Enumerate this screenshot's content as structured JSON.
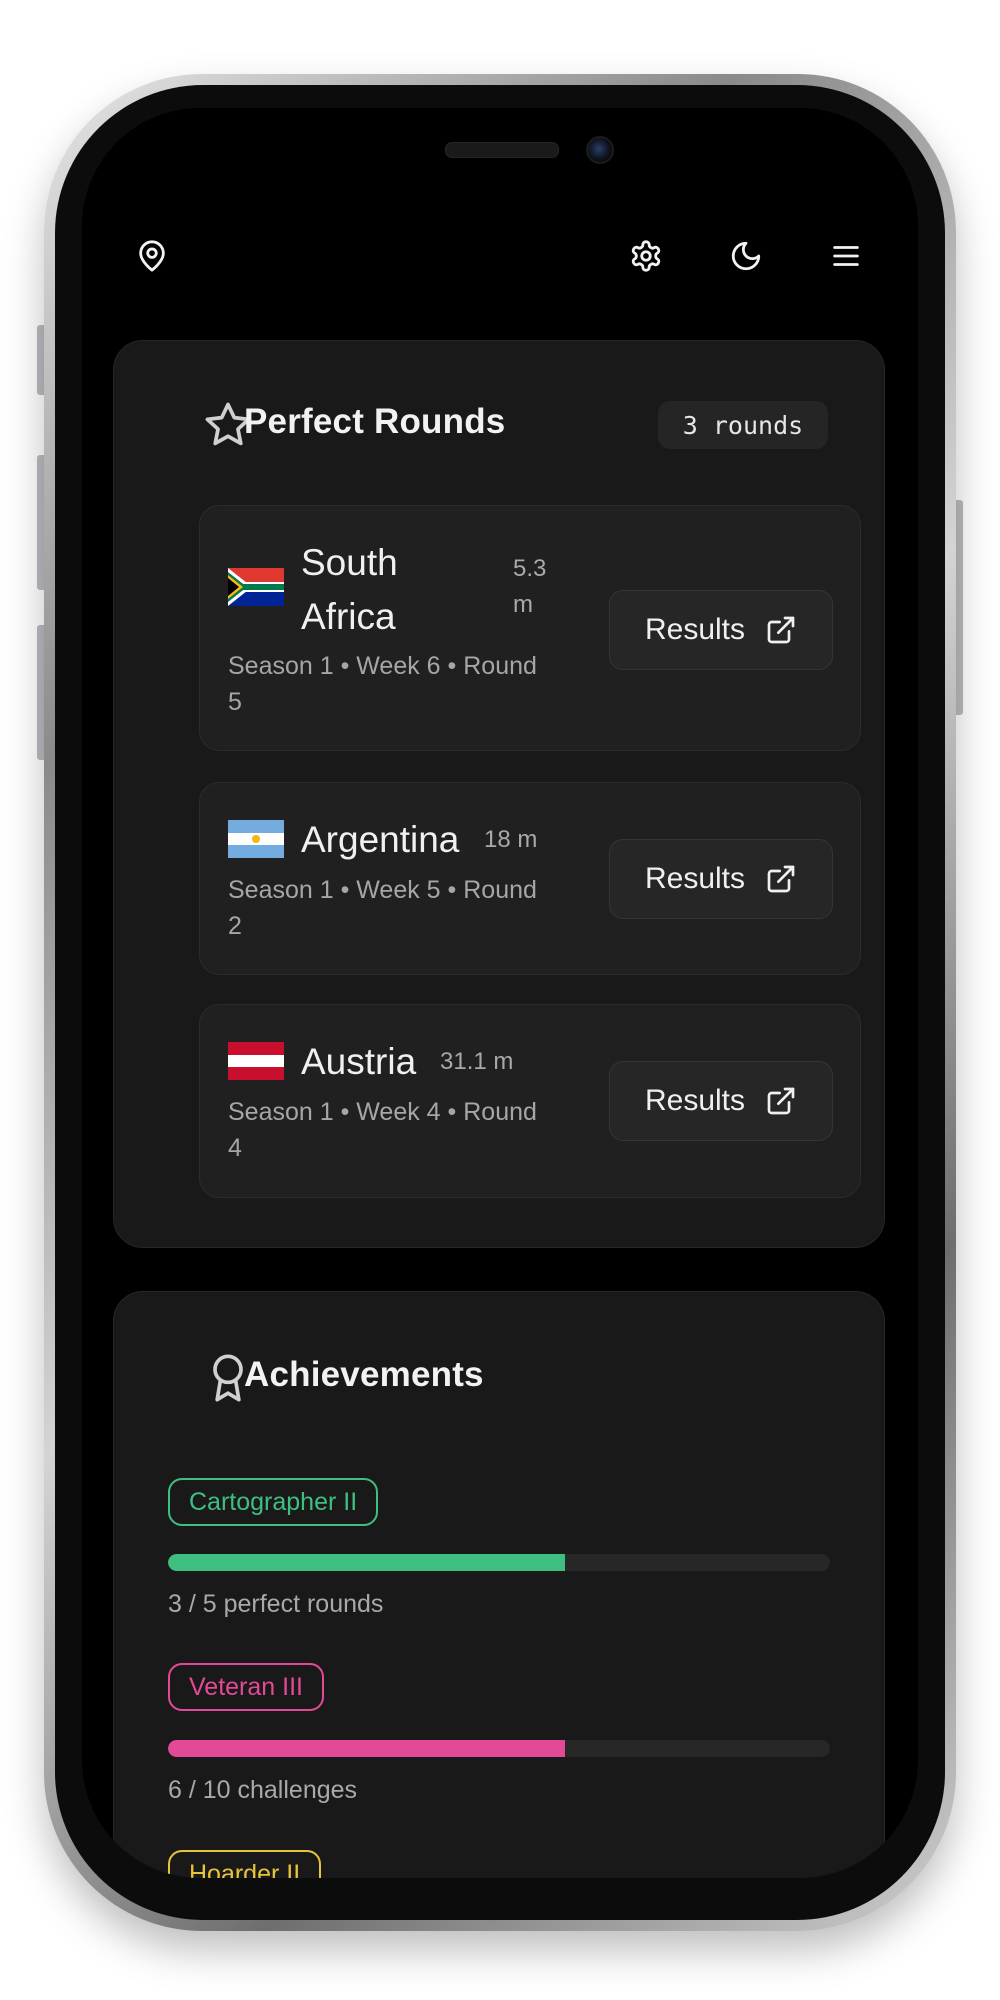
{
  "header": {
    "icons": [
      "map-pin-icon",
      "gear-icon",
      "moon-icon",
      "menu-icon"
    ]
  },
  "perfect_rounds": {
    "title": "Perfect Rounds",
    "count_badge": "3 rounds",
    "rounds": [
      {
        "country_line1": "South",
        "country_line2": "Africa",
        "distance_line1": "5.3",
        "distance_line2": "m",
        "meta_line1": "Season 1 • Week 6 • Round",
        "meta_line2": "5",
        "button_label": "Results"
      },
      {
        "country": "Argentina",
        "distance": "18 m",
        "meta_line1": "Season 1 • Week 5 • Round",
        "meta_line2": "2",
        "button_label": "Results"
      },
      {
        "country": "Austria",
        "distance": "31.1 m",
        "meta_line1": "Season 1 • Week 4 • Round",
        "meta_line2": "4",
        "button_label": "Results"
      }
    ]
  },
  "achievements": {
    "title": "Achievements",
    "items": [
      {
        "name": "Cartographer II",
        "caption": "3 / 5 perfect rounds",
        "progress": 0.6,
        "color": "#3fbf7f"
      },
      {
        "name": "Veteran III",
        "caption": "6 / 10 challenges",
        "progress": 0.6,
        "color": "#e24a97"
      },
      {
        "name": "Hoarder II",
        "color": "#e6c53a"
      }
    ]
  }
}
